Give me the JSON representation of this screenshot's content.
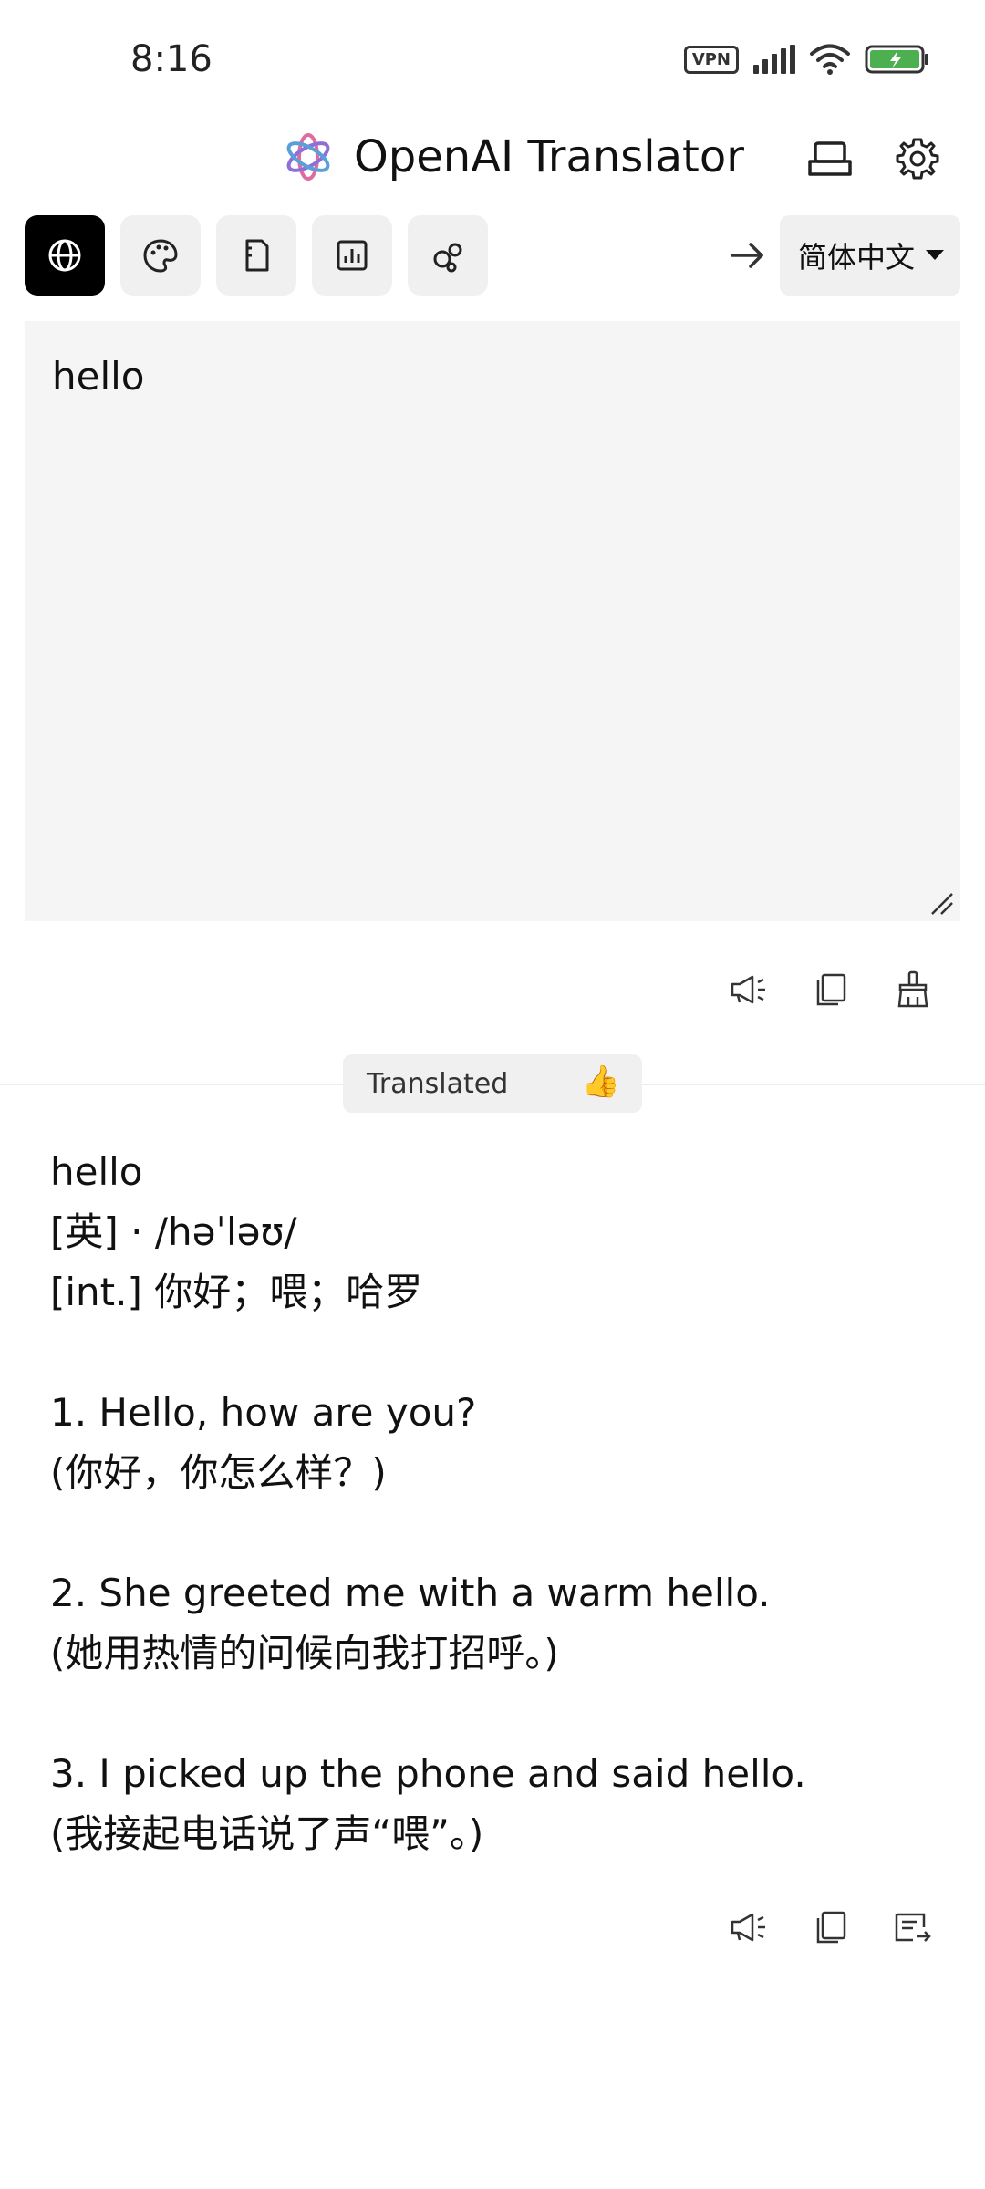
{
  "status_bar": {
    "time": "8:16",
    "vpn": "VPN",
    "battery_color": "#4caf50"
  },
  "header": {
    "title": "OpenAI Translator",
    "logo_colors": [
      "#e06c9f",
      "#8e6fd8",
      "#5aa0d8"
    ]
  },
  "toolbar": {
    "modes": [
      {
        "icon": "globe-icon",
        "active": true
      },
      {
        "icon": "palette-icon",
        "active": false
      },
      {
        "icon": "document-icon",
        "active": false
      },
      {
        "icon": "chart-icon",
        "active": false
      },
      {
        "icon": "bubbles-icon",
        "active": false
      }
    ],
    "target_language": "简体中文"
  },
  "input": {
    "value": "hello"
  },
  "result": {
    "status": "Translated",
    "status_emoji": "👍",
    "lines": [
      "hello",
      "[英] · /həˈləʊ/",
      "[int.] 你好；喂；哈罗",
      "",
      "1. Hello, how are you?",
      "(你好，你怎么样？)",
      "",
      "2. She greeted me with a warm hello.",
      "(她用热情的问候向我打招呼。)",
      "",
      "3. I picked up the phone and said hello.",
      "(我接起电话说了声“喂”。)"
    ]
  }
}
